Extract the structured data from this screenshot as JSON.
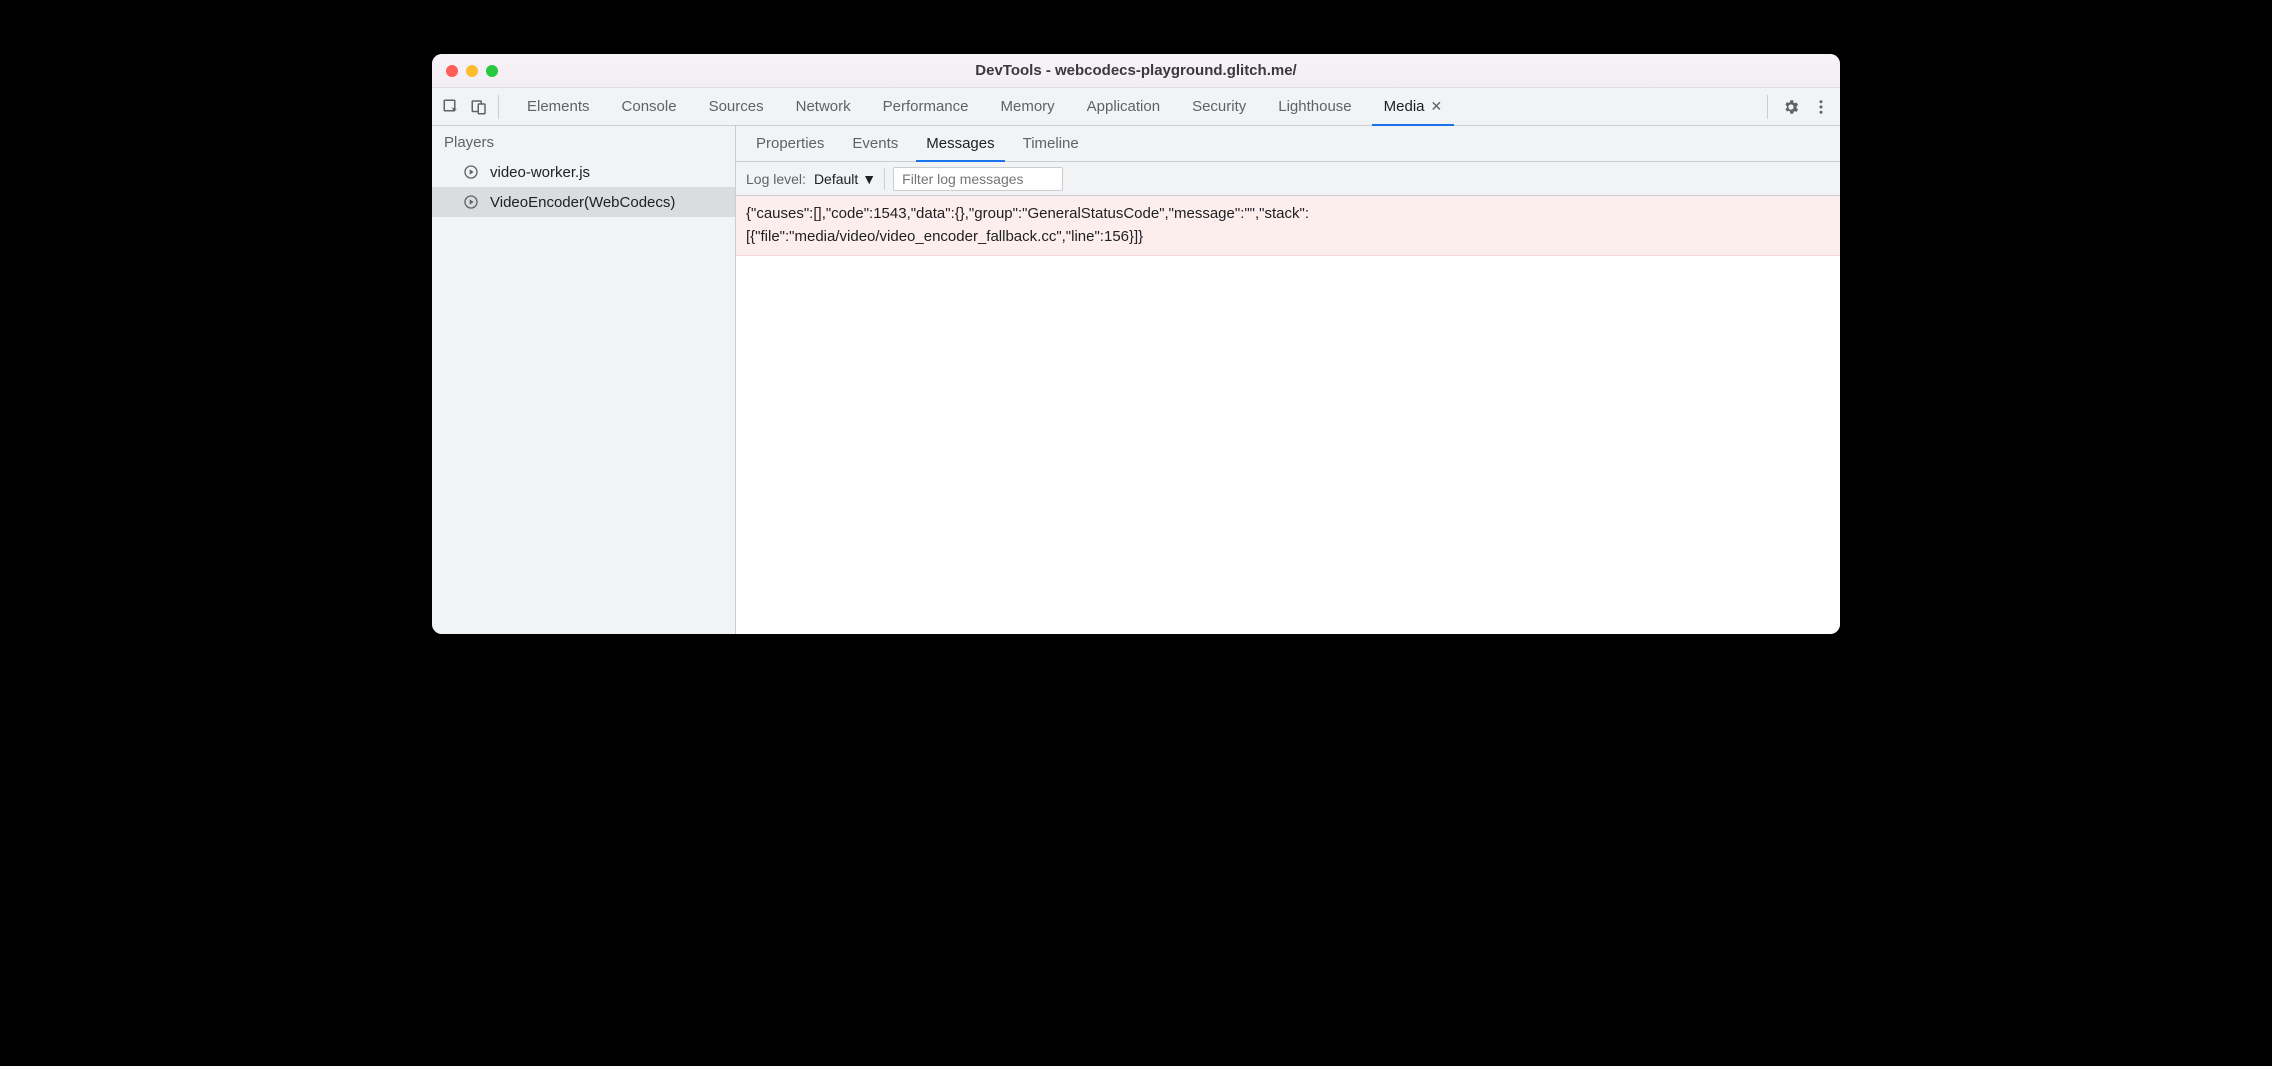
{
  "window": {
    "title": "DevTools - webcodecs-playground.glitch.me/"
  },
  "toolbar": {
    "tabs": [
      "Elements",
      "Console",
      "Sources",
      "Network",
      "Performance",
      "Memory",
      "Application",
      "Security",
      "Lighthouse",
      "Media"
    ],
    "active_tab_index": 9
  },
  "sidebar": {
    "heading": "Players",
    "items": [
      {
        "label": "video-worker.js"
      },
      {
        "label": "VideoEncoder(WebCodecs)"
      }
    ],
    "selected_index": 1
  },
  "subtabs": {
    "items": [
      "Properties",
      "Events",
      "Messages",
      "Timeline"
    ],
    "active_index": 2
  },
  "filterbar": {
    "loglevel_label": "Log level:",
    "loglevel_value": "Default",
    "filter_placeholder": "Filter log messages"
  },
  "messages": [
    "{\"causes\":[],\"code\":1543,\"data\":{},\"group\":\"GeneralStatusCode\",\"message\":\"\",\"stack\":\n[{\"file\":\"media/video/video_encoder_fallback.cc\",\"line\":156}]}"
  ]
}
